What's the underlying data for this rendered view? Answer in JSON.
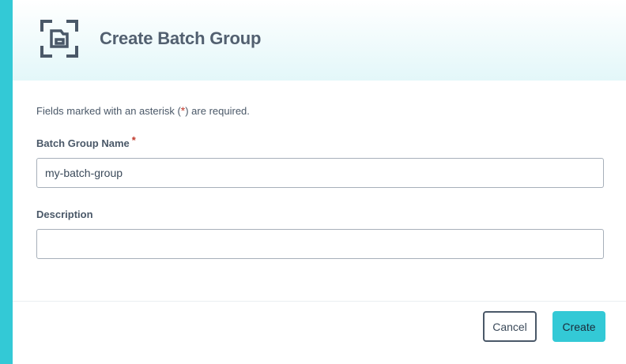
{
  "dialog": {
    "title": "Create Batch Group",
    "icon": "batch-group-icon"
  },
  "form": {
    "required_hint": {
      "before": "Fields marked with an asterisk (",
      "star": "*",
      "after": ") are required."
    },
    "name": {
      "label": "Batch Group Name",
      "required_marker": "*",
      "value": "my-batch-group"
    },
    "description": {
      "label": "Description",
      "value": ""
    }
  },
  "footer": {
    "cancel_label": "Cancel",
    "create_label": "Create"
  },
  "colors": {
    "accent": "#33c9d6",
    "required": "#c0392b",
    "title": "#526070"
  }
}
